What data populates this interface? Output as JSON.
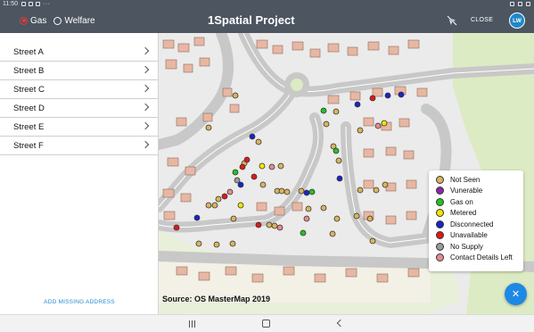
{
  "status_bar": {
    "time": "11:50",
    "more": "···"
  },
  "header": {
    "radio_options": [
      {
        "label": "Gas",
        "selected": true
      },
      {
        "label": "Welfare",
        "selected": false
      }
    ],
    "title": "1Spatial Project",
    "close_label": "CLOSE",
    "user_initials": "LW"
  },
  "sidebar": {
    "streets": [
      {
        "label": "Street A"
      },
      {
        "label": "Street B"
      },
      {
        "label": "Street C"
      },
      {
        "label": "Street D"
      },
      {
        "label": "Street E"
      },
      {
        "label": "Street F"
      }
    ],
    "add_missing_label": "ADD MISSING ADDRESS"
  },
  "map": {
    "source": "Source: OS MasterMap 2019",
    "legend": [
      {
        "label": "Not Seen",
        "color": "#d9b45c"
      },
      {
        "label": "Vunerable",
        "color": "#8e24aa"
      },
      {
        "label": "Gas on",
        "color": "#22c322"
      },
      {
        "label": "Metered",
        "color": "#f2e600"
      },
      {
        "label": "Disconnected",
        "color": "#1a23c8"
      },
      {
        "label": "Unavailable",
        "color": "#e01818"
      },
      {
        "label": "No Supply",
        "color": "#9a9a9a"
      },
      {
        "label": "Contact Details Left",
        "color": "#e88a8a"
      }
    ],
    "fab_icon": "close-icon"
  },
  "navigation": {
    "icons": [
      "recents-icon",
      "home-icon",
      "back-icon"
    ]
  }
}
